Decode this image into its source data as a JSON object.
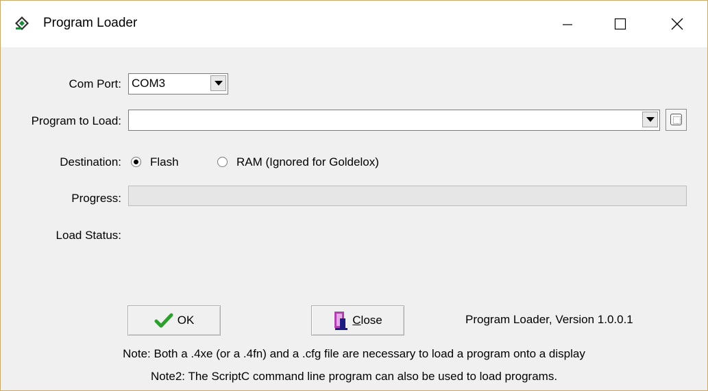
{
  "window": {
    "title": "Program Loader",
    "icon": "app-logo-icon",
    "controls": [
      "minimize-icon",
      "maximize-icon",
      "close-icon"
    ]
  },
  "form": {
    "com_port_label": "Com Port:",
    "com_port_value": "COM3",
    "program_label": "Program to Load:",
    "program_value": "",
    "destination_label": "Destination:",
    "destination_options": [
      {
        "label": "Flash",
        "selected": true
      },
      {
        "label": "RAM (Ignored for Goldelox)",
        "selected": false
      }
    ],
    "progress_label": "Progress:",
    "progress_value": 0,
    "load_status_label": "Load Status:",
    "load_status_value": ""
  },
  "buttons": {
    "ok_label": "OK",
    "close_first": "C",
    "close_rest": "lose",
    "ok_icon": "checkmark-icon",
    "close_icon": "door-icon"
  },
  "version_text": "Program Loader, Version 1.0.0.1",
  "notes": {
    "note1": "Note: Both a .4xe (or a .4fn) and a .cfg file are necessary to load a program onto a display",
    "note2": "Note2: The ScriptC command line program can also be used to load programs."
  }
}
